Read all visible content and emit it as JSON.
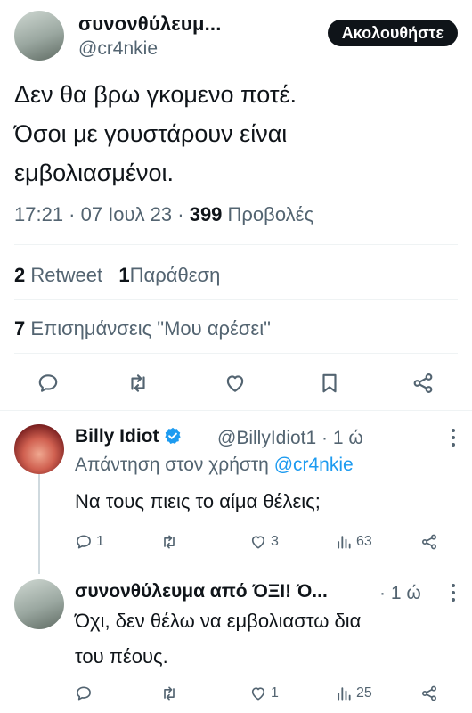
{
  "main_tweet": {
    "display_name": "συνονθύλευμ...",
    "handle": "@cr4nkie",
    "follow_label": "Ακολουθήστε",
    "text_lines": [
      "Δεν θα βρω γκομενο ποτέ.",
      "Όσοι με γουστάρουν είναι",
      "εμβολιασμένοι."
    ],
    "time": "17:21 · 07 Ιουλ 23 · ",
    "views_count": "399",
    "views_label": " Προβολές",
    "retweets_count": "2",
    "retweets_label": " Retweet",
    "quotes_count": "1",
    "quotes_label": "Παράθεση",
    "likes_count": "7",
    "likes_label": " Επισημάνσεις \"Μου αρέσει\""
  },
  "replies": [
    {
      "display_name": "Billy Idiot",
      "handle": "@BillyIdiot1",
      "age": " · 1 ώ",
      "reply_to_prefix": "Απάντηση στον χρήστη ",
      "reply_to_mention": "@cr4nkie",
      "text_lines": [
        "Να τους πιεις το αίμα θέλεις;"
      ],
      "reply_count": "1",
      "retweet_count": "",
      "like_count": "3",
      "views": "63"
    },
    {
      "display_name": "συνονθύλευμα από ΌΞΙ! Ό...",
      "age": " · 1 ώ",
      "text_lines": [
        "Όχι, δεν θέλω να εμβολιαστω δια",
        "του πέους."
      ],
      "reply_count": "",
      "retweet_count": "",
      "like_count": "1",
      "views": "25"
    }
  ],
  "icons": {
    "reply": "comment-bubble-icon",
    "retweet": "retweet-icon",
    "like": "heart-icon",
    "bookmark": "bookmark-icon",
    "share": "share-icon",
    "views": "bar-chart-icon",
    "verified": "verified-badge-icon",
    "more": "more-vertical-icon"
  },
  "colors": {
    "text": "#0f1419",
    "secondary": "#536471",
    "accent": "#1d9bf0",
    "follow_bg": "#0f1419"
  }
}
